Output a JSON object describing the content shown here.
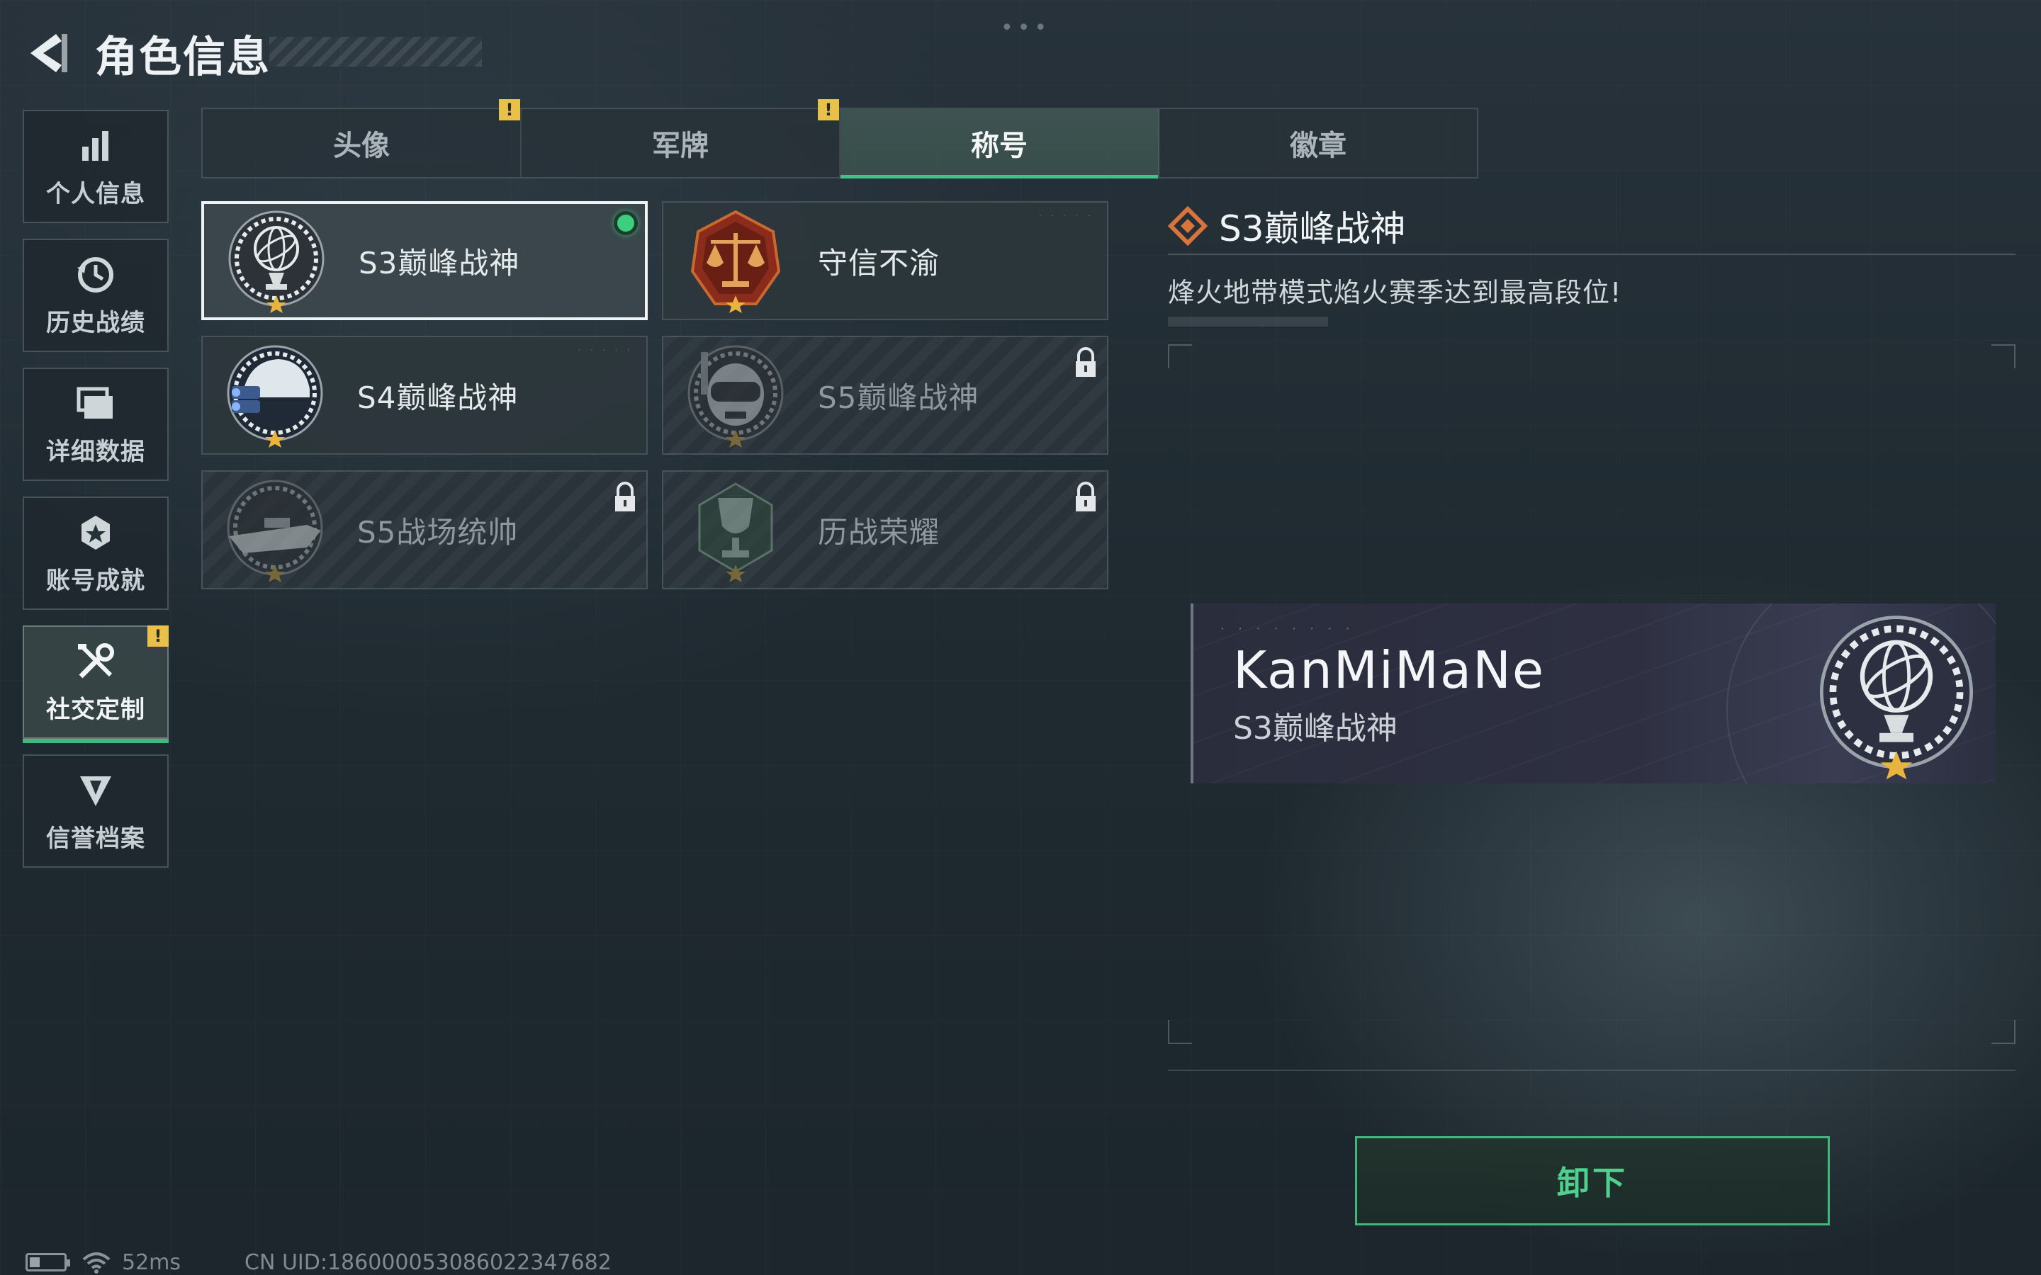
{
  "header": {
    "title": "角色信息"
  },
  "sidebar": {
    "items": [
      {
        "label": "个人信息",
        "icon": "bar-chart-icon",
        "active": false,
        "warn": false
      },
      {
        "label": "历史战绩",
        "icon": "clock-history-icon",
        "active": false,
        "warn": false
      },
      {
        "label": "详细数据",
        "icon": "folder-icon",
        "active": false,
        "warn": false
      },
      {
        "label": "账号成就",
        "icon": "achievement-badge-icon",
        "active": false,
        "warn": false
      },
      {
        "label": "社交定制",
        "icon": "tools-icon",
        "active": true,
        "warn": true
      },
      {
        "label": "信誉档案",
        "icon": "shield-emblem-icon",
        "active": false,
        "warn": false
      }
    ]
  },
  "tabs": [
    {
      "label": "头像",
      "active": false,
      "warn": true
    },
    {
      "label": "军牌",
      "active": false,
      "warn": true
    },
    {
      "label": "称号",
      "active": true,
      "warn": false
    },
    {
      "label": "徽章",
      "active": false,
      "warn": false
    }
  ],
  "warn_symbol": "!",
  "cards": [
    {
      "name": "S3巅峰战神",
      "emblem": "armillary-sphere-emblem-icon",
      "selected": true,
      "equipped": true,
      "locked": false
    },
    {
      "name": "守信不渝",
      "emblem": "scales-of-justice-emblem-icon",
      "selected": false,
      "equipped": false,
      "locked": false
    },
    {
      "name": "S4巅峰战神",
      "emblem": "night-vision-helmet-emblem-icon",
      "selected": false,
      "equipped": false,
      "locked": false
    },
    {
      "name": "S5巅峰战神",
      "emblem": "diving-mask-skull-emblem-icon",
      "selected": false,
      "equipped": false,
      "locked": true
    },
    {
      "name": "S5战场统帅",
      "emblem": "speedboat-emblem-icon",
      "selected": false,
      "equipped": false,
      "locked": true
    },
    {
      "name": "历战荣耀",
      "emblem": "trophy-emblem-icon",
      "selected": false,
      "equipped": false,
      "locked": true
    }
  ],
  "detail": {
    "title": "S3巅峰战神",
    "description": "烽火地带模式焰火赛季达到最高段位!"
  },
  "nameplate": {
    "player_name": "KanMiMaNe",
    "title": "S3巅峰战神",
    "emblem": "armillary-sphere-emblem-icon"
  },
  "unequip_label": "卸下",
  "status": {
    "ping": "52ms",
    "uid": "CN UID:1860000530860223476​82"
  },
  "colors": {
    "accent_green": "#3fb87d",
    "warn_yellow": "#e8c04a",
    "detail_icon_orange": "#d9743c"
  }
}
